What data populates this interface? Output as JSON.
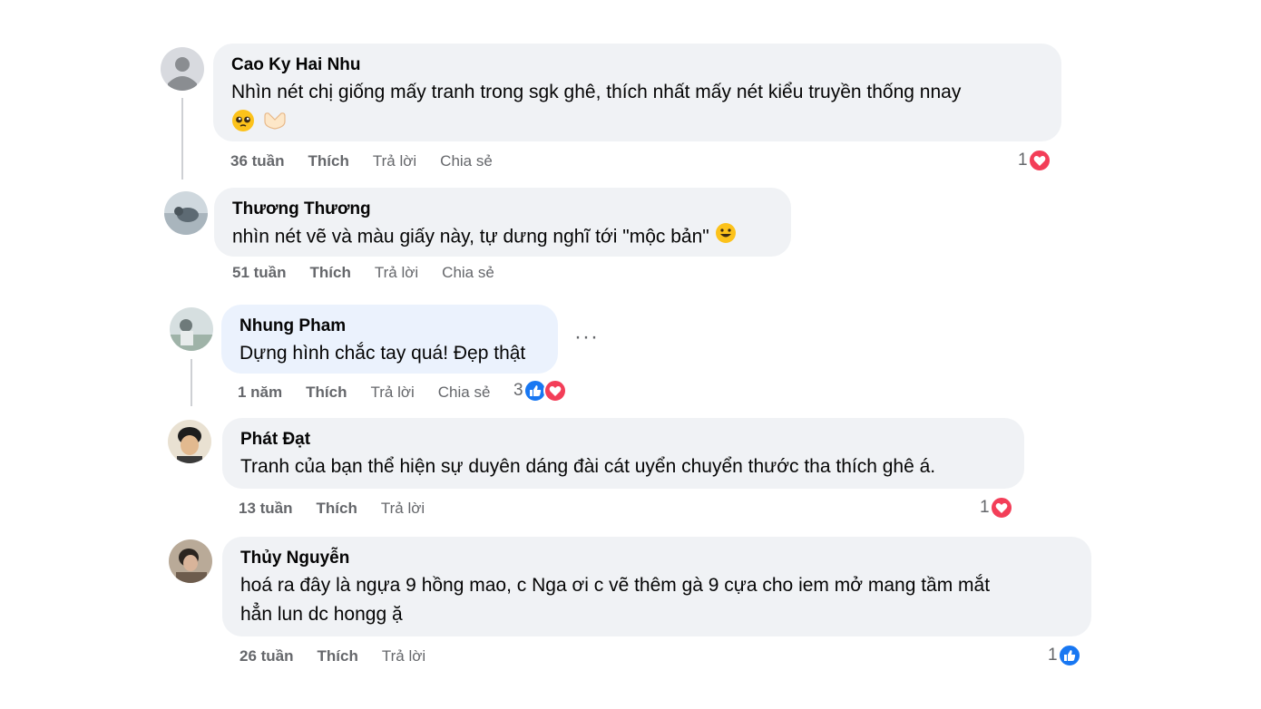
{
  "comments": [
    {
      "author": "Cao Ky Hai Nhu",
      "text": "Nhìn nét chị giống mấy tranh trong sgk ghê, thích nhất mấy nét kiểu truyền thống nnay",
      "emojis": [
        "pleading-face-emoji",
        "heart-hands-emoji"
      ],
      "time": "36 tuần",
      "like": "Thích",
      "reply": "Trả lời",
      "share": "Chia sẻ",
      "reaction_count": "1",
      "reactions": [
        "heart"
      ]
    },
    {
      "author": "Thương Thương",
      "text": "nhìn nét vẽ và màu giấy này, tự dưng nghĩ tới \"mộc bản\"",
      "emojis": [
        "smiling-face-emoji"
      ],
      "time": "51 tuần",
      "like": "Thích",
      "reply": "Trả lời",
      "share": "Chia sẻ"
    },
    {
      "author": "Nhung Pham",
      "text": "Dựng hình chắc tay quá! Đẹp thật",
      "time": "1 năm",
      "like": "Thích",
      "reply": "Trả lời",
      "share": "Chia sẻ",
      "reaction_count": "3",
      "reactions": [
        "like",
        "heart"
      ],
      "more_label": "···"
    },
    {
      "author": "Phát Đạt",
      "text": "Tranh của bạn thể hiện sự duyên dáng đài cát uyển chuyển thước tha thích ghê á.",
      "time": "13 tuần",
      "like": "Thích",
      "reply": "Trả lời",
      "reaction_count": "1",
      "reactions": [
        "heart"
      ]
    },
    {
      "author": "Thủy Nguyễn",
      "text_line1": "hoá ra đây là ngựa 9 hồng mao, c Nga ơi c vẽ thêm gà 9 cựa cho iem mở mang tầm mắt",
      "text_line2": "hẳn lun dc hongg ặ",
      "time": "26 tuần",
      "like": "Thích",
      "reply": "Trả lời",
      "reaction_count": "1",
      "reactions": [
        "like"
      ]
    }
  ],
  "colors": {
    "bubble": "#f0f2f5",
    "bubble_highlight": "#ebf2fd",
    "meta_text": "#65676b",
    "heart": "#f33e58",
    "like": "#1877f2"
  }
}
